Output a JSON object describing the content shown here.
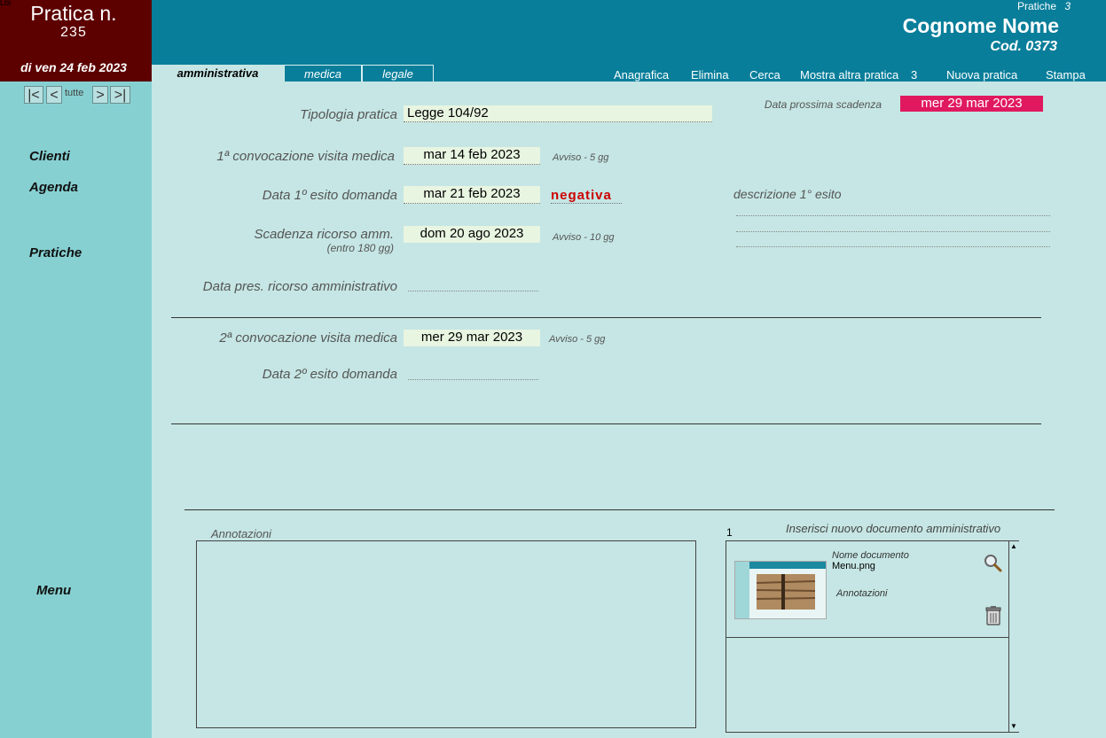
{
  "header": {
    "tiny_label": "Lbl",
    "title": "Pratica n.",
    "number": "235",
    "date": "di ven 24 feb 2023",
    "pratiche_label": "Pratiche",
    "pratiche_count": "3",
    "client_name": "Cognome Nome",
    "client_code": "Cod. 0373"
  },
  "nav": {
    "first": "|<",
    "prev": "<",
    "all": "tutte",
    "next": ">",
    "last": ">|"
  },
  "sidebar": {
    "clienti": "Clienti",
    "agenda": "Agenda",
    "pratiche": "Pratiche",
    "menu": "Menu"
  },
  "tabs": [
    "amministrativa",
    "medica",
    "legale"
  ],
  "menu": {
    "anagrafica": "Anagrafica",
    "elimina": "Elimina",
    "cerca": "Cerca",
    "mostra": "Mostra altra pratica",
    "mostra_count": "3",
    "nuova": "Nuova pratica",
    "stampa": "Stampa"
  },
  "form": {
    "tipologia_label": "Tipologia pratica",
    "tipologia_value": "Legge 104/92",
    "scadenza_label": "Data prossima scadenza",
    "scadenza_value": "mer 29 mar 2023",
    "conv1_label": "1ª convocazione visita medica",
    "conv1_value": "mar 14 feb 2023",
    "conv1_hint": "Avviso - 5 gg",
    "esito1_label": "Data 1º esito domanda",
    "esito1_value": "mar 21 feb 2023",
    "esito1_result": "negativa",
    "descr1_label": "descrizione 1° esito",
    "ricorso_label": "Scadenza ricorso amm.",
    "ricorso_sub": "(entro 180 gg)",
    "ricorso_value": "dom 20 ago 2023",
    "ricorso_hint": "Avviso - 10 gg",
    "pres_label": "Data pres. ricorso amministrativo",
    "conv2_label": "2ª convocazione visita medica",
    "conv2_value": "mer 29 mar 2023",
    "conv2_hint": "Avviso -  5 gg",
    "esito2_label": "Data 2º esito domanda"
  },
  "docs": {
    "annotazioni_label": "Annotazioni",
    "count": "1",
    "insert_label": "Inserisci nuovo documento amministrativo",
    "doc_name_label": "Nome documento",
    "doc_name": "Menu.png",
    "doc_annot_label": "Annotazioni"
  },
  "colors": {
    "deadline_bg": "#e0195f",
    "negative": "#cc0000",
    "topbar": "#087e9a",
    "header_dark": "#5c0000"
  }
}
